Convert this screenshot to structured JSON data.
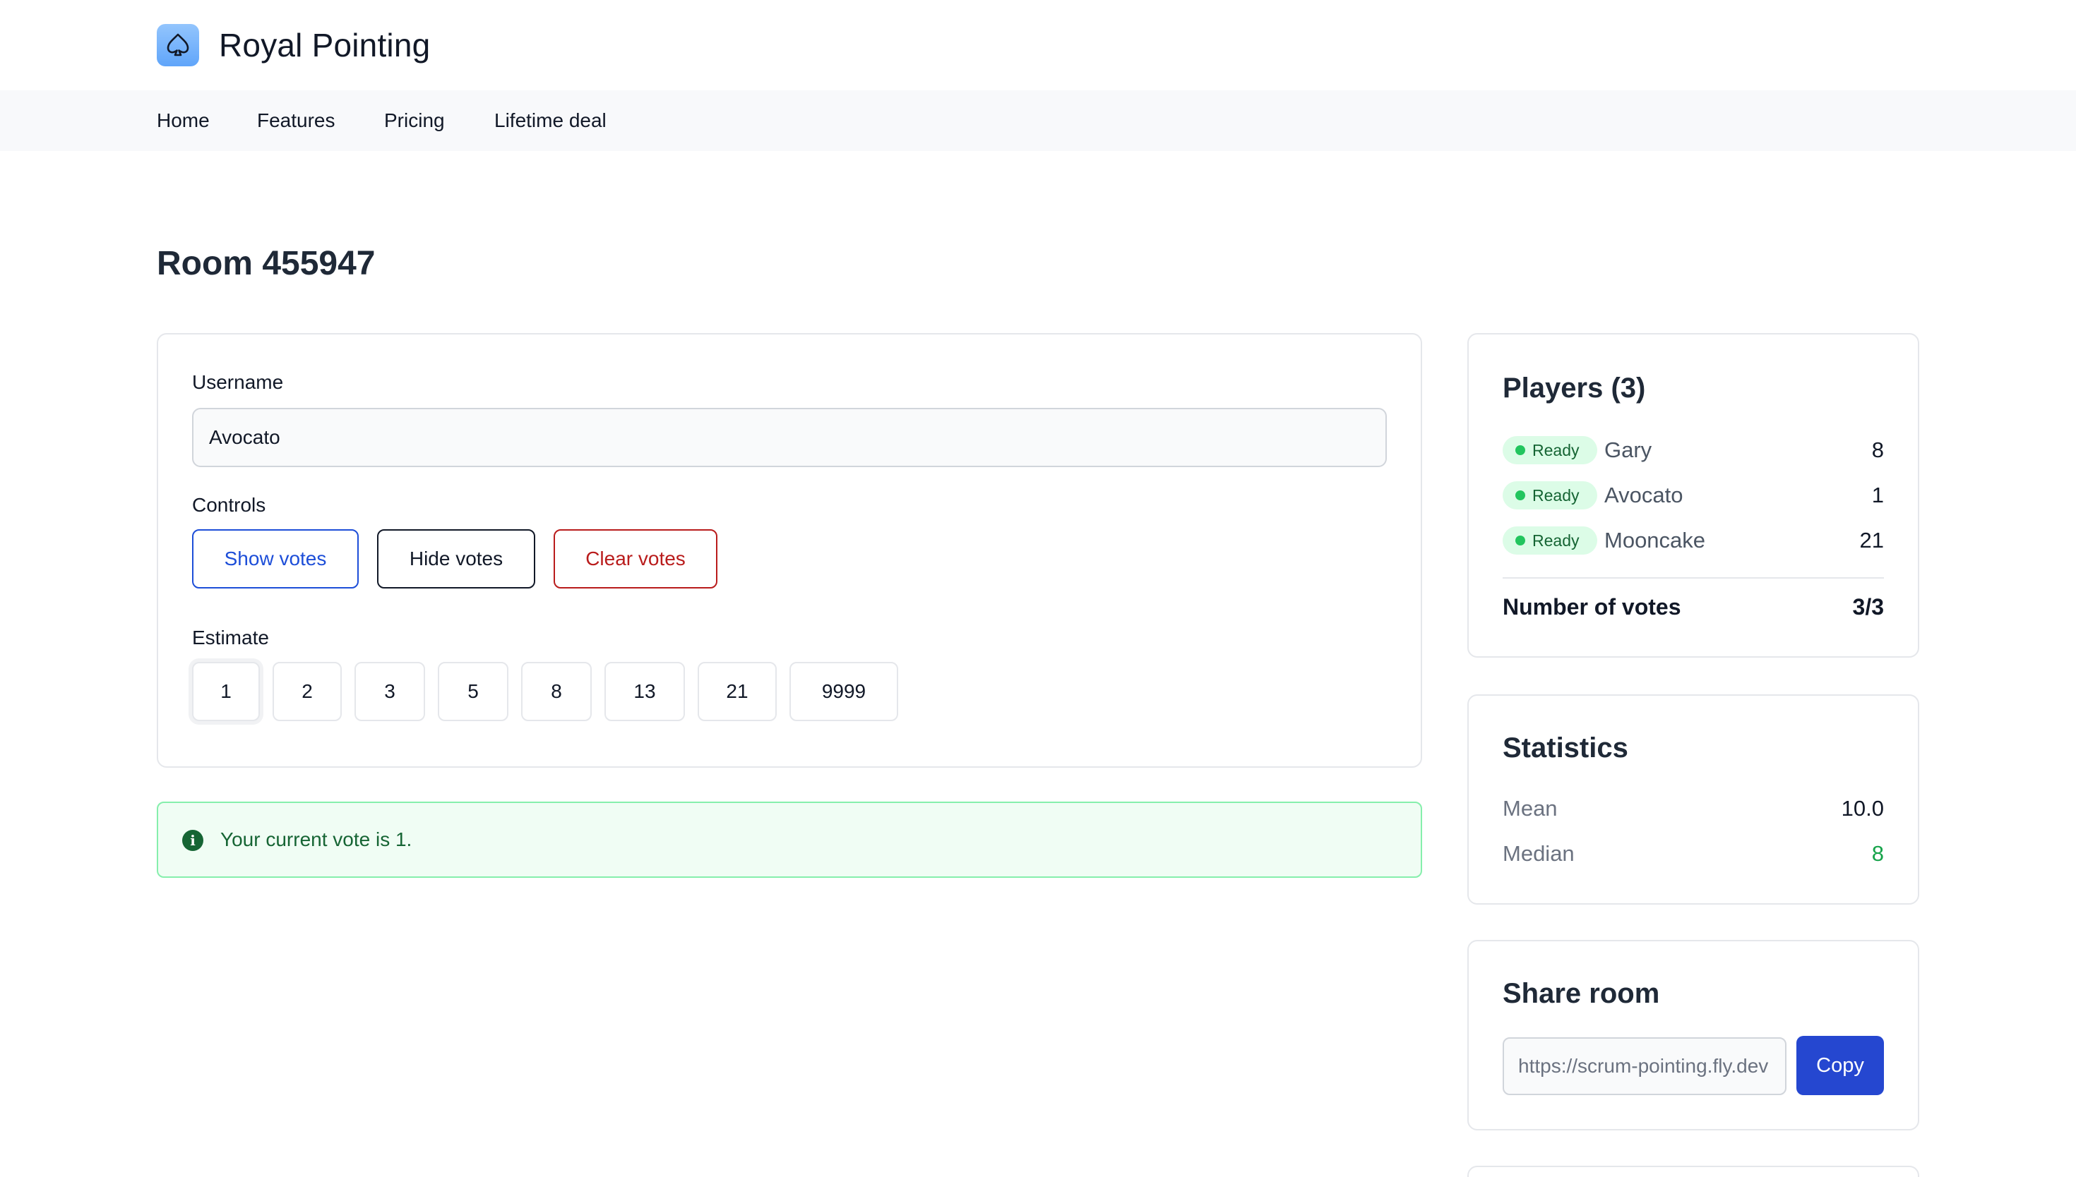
{
  "app": {
    "name": "Royal Pointing",
    "logo_icon": "spade-icon"
  },
  "nav": [
    {
      "label": "Home"
    },
    {
      "label": "Features"
    },
    {
      "label": "Pricing"
    },
    {
      "label": "Lifetime deal"
    }
  ],
  "room": {
    "title": "Room 455947"
  },
  "form": {
    "username_label": "Username",
    "username_value": "Avocato",
    "controls_label": "Controls",
    "show_votes": "Show votes",
    "hide_votes": "Hide votes",
    "clear_votes": "Clear votes",
    "estimate_label": "Estimate",
    "estimates": [
      "1",
      "2",
      "3",
      "5",
      "8",
      "13",
      "21",
      "9999"
    ],
    "selected_estimate": "1"
  },
  "alert": {
    "icon": "info-icon",
    "text": "Your current vote is 1."
  },
  "players": {
    "title": "Players (3)",
    "list": [
      {
        "status": "Ready",
        "name": "Gary",
        "vote": "8"
      },
      {
        "status": "Ready",
        "name": "Avocato",
        "vote": "1"
      },
      {
        "status": "Ready",
        "name": "Mooncake",
        "vote": "21"
      }
    ],
    "votes_label": "Number of votes",
    "votes_value": "3/3"
  },
  "statistics": {
    "title": "Statistics",
    "mean_label": "Mean",
    "mean_value": "10.0",
    "median_label": "Median",
    "median_value": "8"
  },
  "share": {
    "title": "Share room",
    "url": "https://scrum-pointing.fly.dev",
    "copy_label": "Copy"
  },
  "colors": {
    "primary": "#2547d0",
    "danger": "#b91c1c",
    "success": "#166534",
    "median_value": "#16a34a"
  }
}
